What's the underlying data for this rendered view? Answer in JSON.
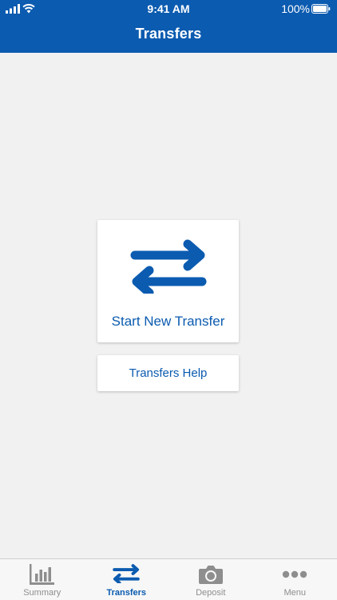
{
  "status_bar": {
    "time": "9:41 AM",
    "battery_percent": "100%",
    "icons": [
      "signal-icon",
      "wifi-icon",
      "battery-icon"
    ]
  },
  "header": {
    "title": "Transfers"
  },
  "main": {
    "start_transfer": {
      "label": "Start New Transfer",
      "icon": "transfer-arrows-icon"
    },
    "help": {
      "label": "Transfers Help"
    }
  },
  "tabbar": {
    "tabs": [
      {
        "label": "Summary",
        "icon": "bar-chart-icon",
        "active": false
      },
      {
        "label": "Transfers",
        "icon": "transfer-arrows-icon",
        "active": true
      },
      {
        "label": "Deposit",
        "icon": "camera-icon",
        "active": false
      },
      {
        "label": "Menu",
        "icon": "more-dots-icon",
        "active": false
      }
    ]
  },
  "colors": {
    "brand_blue": "#0b5bb0",
    "background": "#f1f1f1",
    "card": "#ffffff",
    "inactive_tab": "#8e8e8e"
  }
}
